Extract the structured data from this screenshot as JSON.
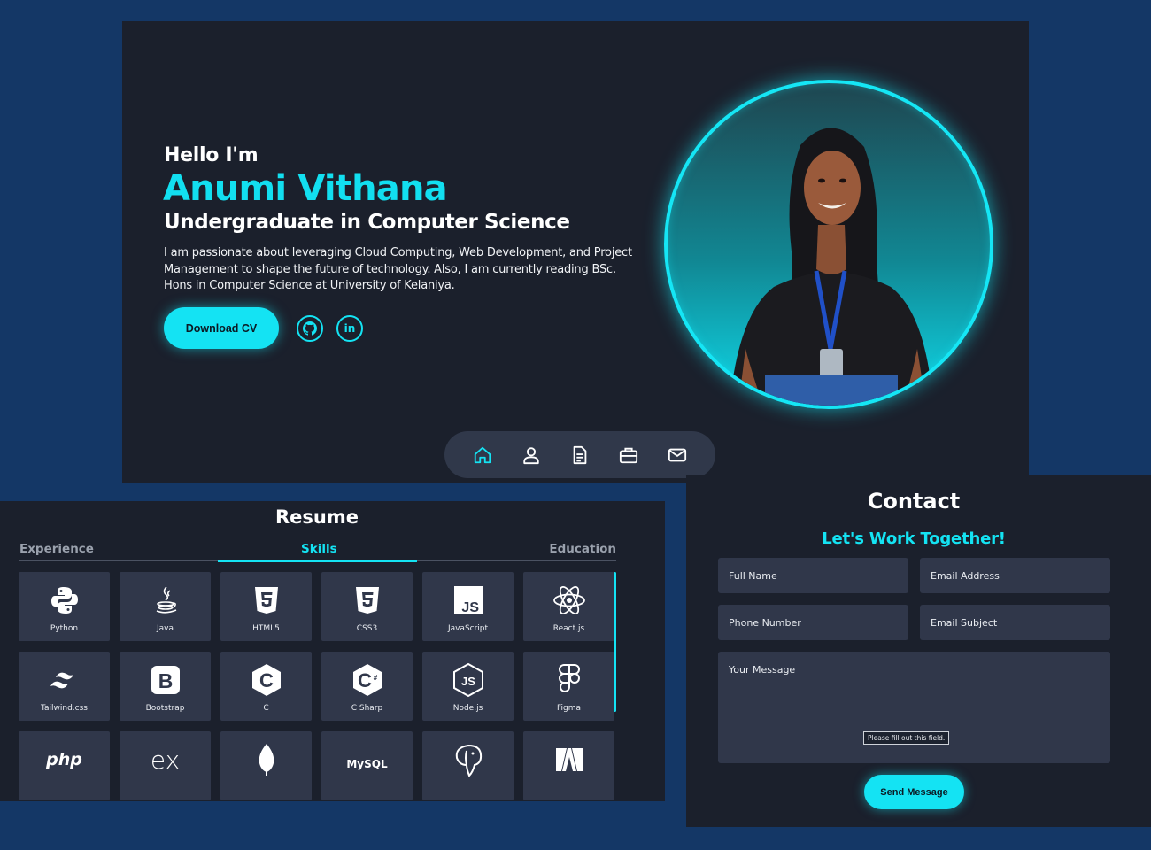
{
  "hero": {
    "greeting": "Hello I'm",
    "name": "Anumi Vithana",
    "role": "Undergraduate in Computer Science",
    "description": "I am passionate about leveraging Cloud Computing, Web Development, and Project Management to shape the future of technology. Also, I am currently reading BSc. Hons in Computer Science at University of Kelaniya.",
    "download_label": "Download CV",
    "social": [
      {
        "icon": "github-icon"
      },
      {
        "icon": "linkedin-icon",
        "text": "in"
      }
    ]
  },
  "navbar": {
    "items": [
      {
        "icon": "home-icon",
        "active": true
      },
      {
        "icon": "user-icon",
        "active": false
      },
      {
        "icon": "document-icon",
        "active": false
      },
      {
        "icon": "briefcase-icon",
        "active": false
      },
      {
        "icon": "mail-icon",
        "active": false
      }
    ]
  },
  "resume": {
    "title": "Resume",
    "tabs": [
      {
        "label": "Experience",
        "active": false
      },
      {
        "label": "Skills",
        "active": true
      },
      {
        "label": "Education",
        "active": false
      }
    ],
    "skills": [
      {
        "label": "Python",
        "icon": "python-icon"
      },
      {
        "label": "Java",
        "icon": "java-icon"
      },
      {
        "label": "HTML5",
        "icon": "html5-icon"
      },
      {
        "label": "CSS3",
        "icon": "css3-icon"
      },
      {
        "label": "JavaScript",
        "icon": "javascript-icon"
      },
      {
        "label": "React.js",
        "icon": "react-icon"
      },
      {
        "label": "Tailwind.css",
        "icon": "tailwind-icon"
      },
      {
        "label": "Bootstrap",
        "icon": "bootstrap-icon"
      },
      {
        "label": "C",
        "icon": "c-icon"
      },
      {
        "label": "C Sharp",
        "icon": "csharp-icon"
      },
      {
        "label": "Node.js",
        "icon": "nodejs-icon"
      },
      {
        "label": "Figma",
        "icon": "figma-icon"
      },
      {
        "label": "",
        "icon": "php-icon",
        "logo_text": "php"
      },
      {
        "label": "",
        "icon": "express-icon",
        "logo_text": "ex"
      },
      {
        "label": "",
        "icon": "mongodb-icon"
      },
      {
        "label": "",
        "icon": "mysql-icon",
        "logo_text": "MySQL"
      },
      {
        "label": "",
        "icon": "postgresql-icon"
      },
      {
        "label": "",
        "icon": "angular-icon"
      }
    ]
  },
  "contact": {
    "title": "Contact",
    "subtitle": "Let's Work Together!",
    "fields": {
      "full_name": "Full Name",
      "email": "Email Address",
      "phone": "Phone Number",
      "subject": "Email Subject",
      "message": "Your Message"
    },
    "validation_tooltip": "Please fill out this field.",
    "send_label": "Send Message"
  },
  "colors": {
    "accent": "#14e3f3",
    "background": "#143766",
    "panel": "#1b202c",
    "card": "#30374a"
  }
}
